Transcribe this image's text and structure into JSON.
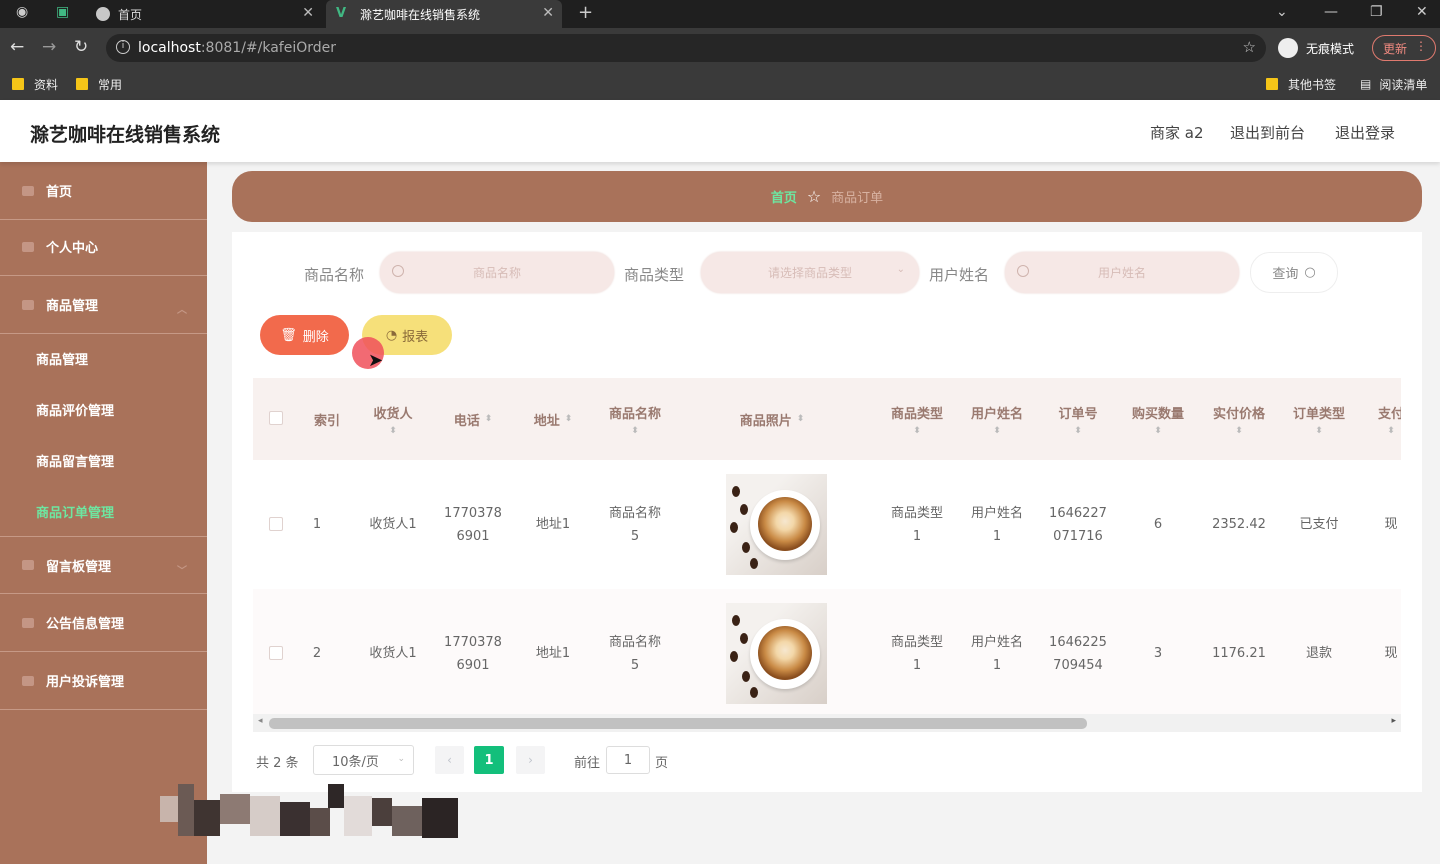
{
  "browser": {
    "tabs": [
      {
        "title": "首页"
      },
      {
        "title": "滁艺咖啡在线销售系统"
      }
    ],
    "url_host": "localhost",
    "url_rest": ":8081/#/kafeiOrder",
    "incognito_label": "无痕模式",
    "update_label": "更新",
    "bookmarks": [
      "资料",
      "常用"
    ],
    "bookmarks_right": [
      "其他书签",
      "阅读清单"
    ]
  },
  "header": {
    "title": "滁艺咖啡在线销售系统",
    "user": "商家 a2",
    "back_front": "退出到前台",
    "logout": "退出登录"
  },
  "sidebar": {
    "items": [
      {
        "label": "首页",
        "icon": "home-icon"
      },
      {
        "label": "个人中心",
        "icon": "user-icon"
      },
      {
        "label": "商品管理",
        "icon": "goods-icon"
      },
      {
        "label": "留言板管理",
        "icon": "message-icon"
      },
      {
        "label": "公告信息管理",
        "icon": "notice-icon"
      },
      {
        "label": "用户投诉管理",
        "icon": "complaint-icon"
      }
    ],
    "sub_items": [
      {
        "label": "商品管理"
      },
      {
        "label": "商品评价管理"
      },
      {
        "label": "商品留言管理"
      },
      {
        "label": "商品订单管理",
        "active": true
      }
    ]
  },
  "breadcrumb": {
    "home": "首页",
    "current": "商品订单"
  },
  "search": {
    "name_label": "商品名称",
    "name_placeholder": "商品名称",
    "type_label": "商品类型",
    "type_placeholder": "请选择商品类型",
    "user_label": "用户姓名",
    "user_placeholder": "用户姓名",
    "query_label": "查询"
  },
  "actions": {
    "delete_label": "删除",
    "report_label": "报表"
  },
  "table": {
    "columns": [
      "索引",
      "收货人",
      "电话",
      "地址",
      "商品名称",
      "商品照片",
      "商品类型",
      "用户姓名",
      "订单号",
      "购买数量",
      "实付价格",
      "订单类型",
      "支付"
    ],
    "rows": [
      {
        "index": "1",
        "receiver": "收货人1",
        "phone": [
          "1770378",
          "6901"
        ],
        "address": "地址1",
        "goods_name": [
          "商品名称",
          "5"
        ],
        "goods_type": [
          "商品类型",
          "1"
        ],
        "user_name": [
          "用户姓名",
          "1"
        ],
        "order_no": [
          "1646227",
          "071716"
        ],
        "quantity": "6",
        "price": "2352.42",
        "order_type": "已支付",
        "pay": "现"
      },
      {
        "index": "2",
        "receiver": "收货人1",
        "phone": [
          "1770378",
          "6901"
        ],
        "address": "地址1",
        "goods_name": [
          "商品名称",
          "5"
        ],
        "goods_type": [
          "商品类型",
          "1"
        ],
        "user_name": [
          "用户姓名",
          "1"
        ],
        "order_no": [
          "1646225",
          "709454"
        ],
        "quantity": "3",
        "price": "1176.21",
        "order_type": "退款",
        "pay": "现"
      }
    ]
  },
  "pagination": {
    "total_text": "共 2 条",
    "page_size": "10条/页",
    "current_page": "1",
    "goto_label": "前往",
    "goto_value": "1",
    "page_unit": "页"
  },
  "colors": {
    "sidebar": "#a9725a",
    "accent_green": "#13bf7b",
    "delete": "#f26a4c",
    "report": "#f6e07a"
  }
}
